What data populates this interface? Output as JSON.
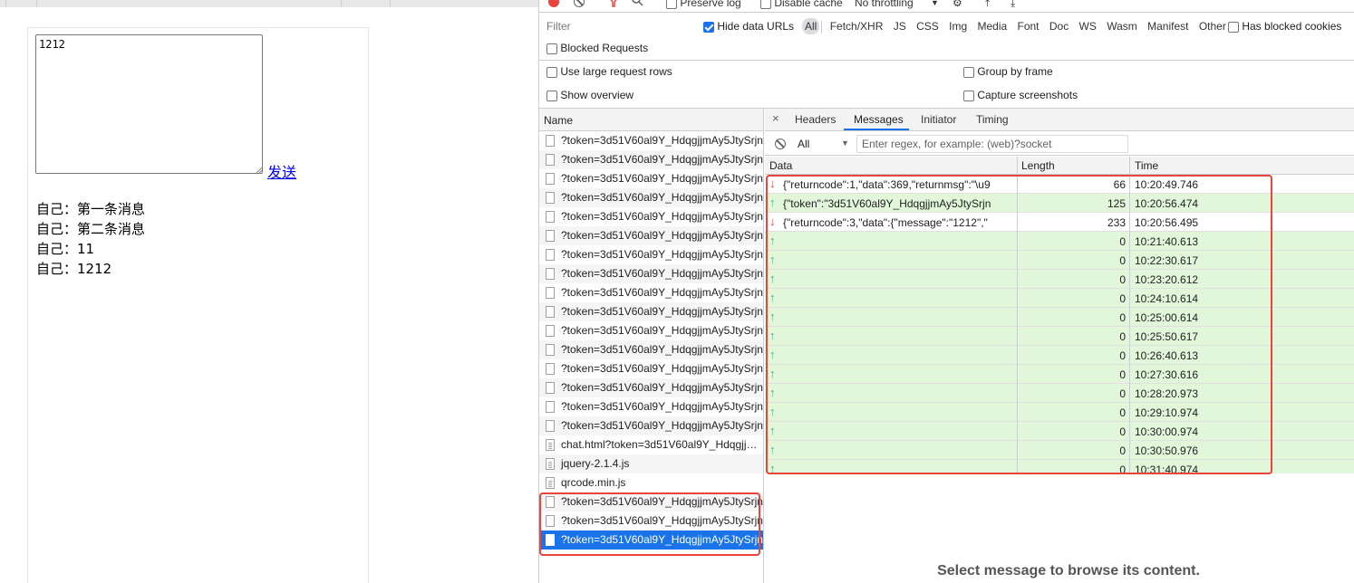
{
  "page": {
    "textarea_value": "1212",
    "send_label": "发送",
    "messages": [
      "自己：第一条消息",
      "自己：第二条消息",
      "自己：11",
      "自己：1212"
    ]
  },
  "devtools": {
    "toolbar": {
      "preserve_log": "Preserve log",
      "disable_cache": "Disable cache",
      "throttling": "No throttling"
    },
    "filter": {
      "placeholder": "Filter",
      "hide_data_urls": "Hide data URLs",
      "types": [
        "All",
        "Fetch/XHR",
        "JS",
        "CSS",
        "Img",
        "Media",
        "Font",
        "Doc",
        "WS",
        "Wasm",
        "Manifest",
        "Other"
      ],
      "has_blocked_cookies": "Has blocked cookies",
      "blocked_requests": "Blocked Requests"
    },
    "options": {
      "large_rows": "Use large request rows",
      "group_by_frame": "Group by frame",
      "show_overview": "Show overview",
      "capture_screenshots": "Capture screenshots"
    },
    "request_list": {
      "header": "Name",
      "rows": [
        "?token=3d51V60al9Y_HdqgjjmAy5JtySrjn",
        "?token=3d51V60al9Y_HdqgjjmAy5JtySrjn",
        "?token=3d51V60al9Y_HdqgjjmAy5JtySrjn",
        "?token=3d51V60al9Y_HdqgjjmAy5JtySrjn",
        "?token=3d51V60al9Y_HdqgjjmAy5JtySrjn",
        "?token=3d51V60al9Y_HdqgjjmAy5JtySrjn",
        "?token=3d51V60al9Y_HdqgjjmAy5JtySrjn",
        "?token=3d51V60al9Y_HdqgjjmAy5JtySrjn",
        "?token=3d51V60al9Y_HdqgjjmAy5JtySrjn",
        "?token=3d51V60al9Y_HdqgjjmAy5JtySrjn",
        "?token=3d51V60al9Y_HdqgjjmAy5JtySrjn",
        "?token=3d51V60al9Y_HdqgjjmAy5JtySrjn",
        "?token=3d51V60al9Y_HdqgjjmAy5JtySrjn",
        "?token=3d51V60al9Y_HdqgjjmAy5JtySrjn",
        "?token=3d51V60al9Y_HdqgjjmAy5JtySrjn",
        "?token=3d51V60al9Y_HdqgjjmAy5JtySrjn",
        "chat.html?token=3d51V60al9Y_HdqgjjmAy5JtySrjn",
        "jquery-2.1.4.js",
        "qrcode.min.js",
        "?token=3d51V60al9Y_HdqgjjmAy5JtySrjn",
        "?token=3d51V60al9Y_HdqgjjmAy5JtySrjn",
        "?token=3d51V60al9Y_HdqgjjmAy5JtySrjn"
      ]
    },
    "detail": {
      "close": "×",
      "tabs": [
        "Headers",
        "Messages",
        "Initiator",
        "Timing"
      ],
      "message_filter": {
        "type": "All",
        "regex_placeholder": "Enter regex, for example: (web)?socket"
      },
      "columns": [
        "Data",
        "Length",
        "Time"
      ],
      "messages": [
        {
          "dir": "recv",
          "data": "{\"returncode\":1,\"data\":369,\"returnmsg\":\"\\u9",
          "length": "66",
          "time": "10:20:49.746"
        },
        {
          "dir": "sent",
          "data": "{\"token\":\"3d51V60al9Y_HdqgjjmAy5JtySrjn",
          "length": "125",
          "time": "10:20:56.474"
        },
        {
          "dir": "recv",
          "data": "{\"returncode\":3,\"data\":{\"message\":\"1212\",\"",
          "length": "233",
          "time": "10:20:56.495"
        },
        {
          "dir": "sent",
          "data": "",
          "length": "0",
          "time": "10:21:40.613"
        },
        {
          "dir": "sent",
          "data": "",
          "length": "0",
          "time": "10:22:30.617"
        },
        {
          "dir": "sent",
          "data": "",
          "length": "0",
          "time": "10:23:20.612"
        },
        {
          "dir": "sent",
          "data": "",
          "length": "0",
          "time": "10:24:10.614"
        },
        {
          "dir": "sent",
          "data": "",
          "length": "0",
          "time": "10:25:00.614"
        },
        {
          "dir": "sent",
          "data": "",
          "length": "0",
          "time": "10:25:50.617"
        },
        {
          "dir": "sent",
          "data": "",
          "length": "0",
          "time": "10:26:40.613"
        },
        {
          "dir": "sent",
          "data": "",
          "length": "0",
          "time": "10:27:30.616"
        },
        {
          "dir": "sent",
          "data": "",
          "length": "0",
          "time": "10:28:20.973"
        },
        {
          "dir": "sent",
          "data": "",
          "length": "0",
          "time": "10:29:10.974"
        },
        {
          "dir": "sent",
          "data": "",
          "length": "0",
          "time": "10:30:00.974"
        },
        {
          "dir": "sent",
          "data": "",
          "length": "0",
          "time": "10:30:50.976"
        },
        {
          "dir": "sent",
          "data": "",
          "length": "0",
          "time": "10:31:40.974"
        }
      ],
      "placeholder": "Select message to browse its content."
    }
  }
}
